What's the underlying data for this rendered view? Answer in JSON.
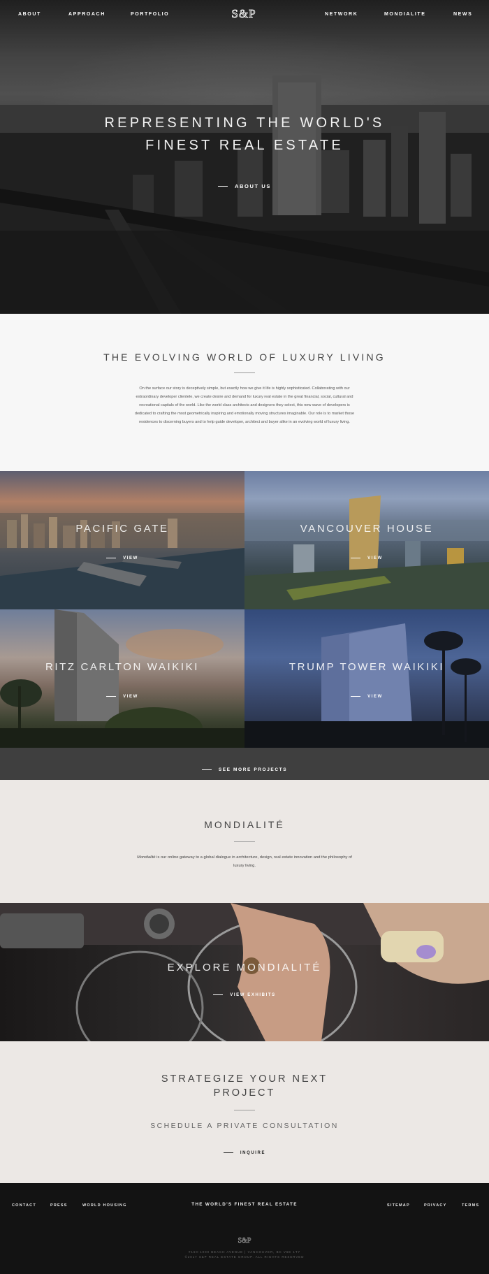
{
  "nav": {
    "left": [
      "ABOUT",
      "APPROACH",
      "PORTFOLIO"
    ],
    "right": [
      "NETWORK",
      "MONDIALITE",
      "NEWS"
    ],
    "logo": "S&P"
  },
  "hero": {
    "title_line1": "REPRESENTING THE WORLD'S",
    "title_line2": "FINEST REAL ESTATE",
    "cta": "ABOUT US"
  },
  "intro": {
    "heading": "THE EVOLVING WORLD OF LUXURY LIVING",
    "body": "On the surface our story is deceptively simple, but exactly how we give it life is highly sophisticated. Collaborating with our extraordinary developer clientele, we create desire and demand for luxury real estate in the great financial, social, cultural and recreational capitals of the world. Like the world class architects and designers they select, this new wave of developers is dedicated to crafting the most geometrically inspiring and emotionally moving structures imaginable. Our role is to market those residences to discerning buyers and to help guide developer, architect and buyer alike in an evolving world of luxury living."
  },
  "projects": [
    {
      "name": "PACIFIC GATE",
      "view": "VIEW"
    },
    {
      "name": "VANCOUVER HOUSE",
      "view": "VIEW"
    },
    {
      "name": "RITZ CARLTON WAIKIKI",
      "view": "VIEW"
    },
    {
      "name": "TRUMP TOWER WAIKIKI",
      "view": "VIEW"
    }
  ],
  "more_projects": "SEE MORE PROJECTS",
  "mondialite": {
    "heading": "MONDIALITÉ",
    "body_em": "Mondialité",
    "body_rest": " is our online gateway to a global dialogue in architecture, design, real estate innovation and the philosophy of luxury living."
  },
  "explore": {
    "title": "EXPLORE MONDIALITÉ",
    "cta": "VIEW EXHIBITS"
  },
  "strategize": {
    "heading_line1": "STRATEGIZE YOUR NEXT",
    "heading_line2": "PROJECT",
    "subheading": "SCHEDULE A PRIVATE CONSULTATION",
    "cta": "INQUIRE"
  },
  "footer": {
    "left": [
      "CONTACT",
      "PRESS",
      "WORLD HOUSING"
    ],
    "tagline": "THE WORLD'S FINEST REAL ESTATE",
    "right": [
      "SITEMAP",
      "PRIVACY",
      "TERMS"
    ],
    "logo": "S&P",
    "address": "#160-1000 BEACH AVENUE | VANCOUVER, BC V6E 1T7",
    "copyright": "©2017 S&P REAL ESTATE GROUP. ALL RIGHTS RESERVED"
  }
}
